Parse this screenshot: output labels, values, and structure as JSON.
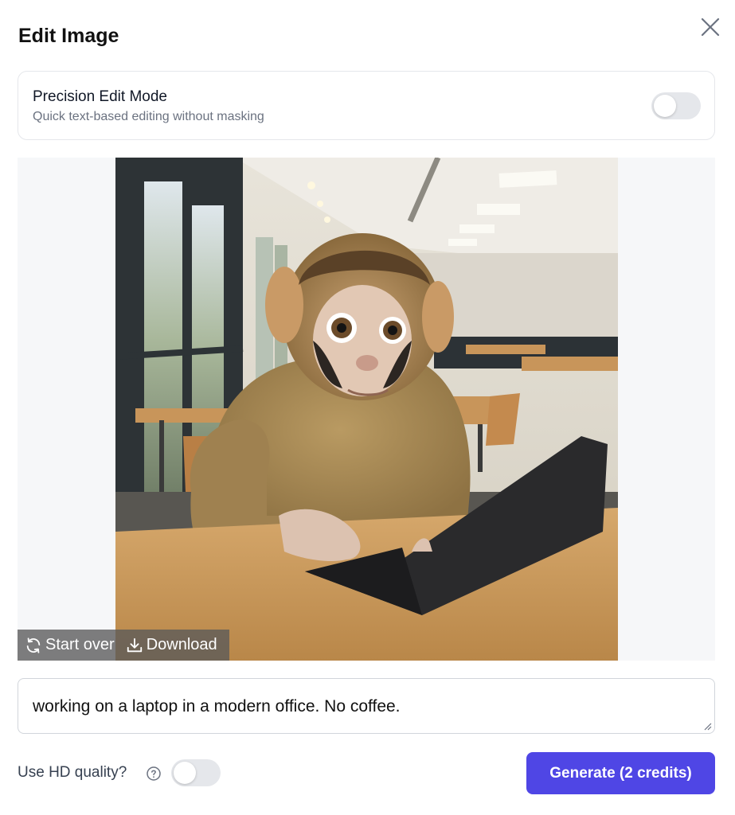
{
  "dialog": {
    "title": "Edit Image"
  },
  "precision_mode": {
    "title": "Precision Edit Mode",
    "subtitle": "Quick text-based editing without masking",
    "enabled": false
  },
  "image_actions": {
    "start_over_label": "Start over",
    "download_label": "Download"
  },
  "prompt": {
    "value": "working on a laptop in a modern office. No coffee."
  },
  "footer": {
    "hd_label": "Use HD quality?",
    "hd_enabled": false,
    "generate_label": "Generate (2 credits)"
  },
  "colors": {
    "accent": "#4f46e5",
    "toggle_off": "#e5e7eb"
  }
}
